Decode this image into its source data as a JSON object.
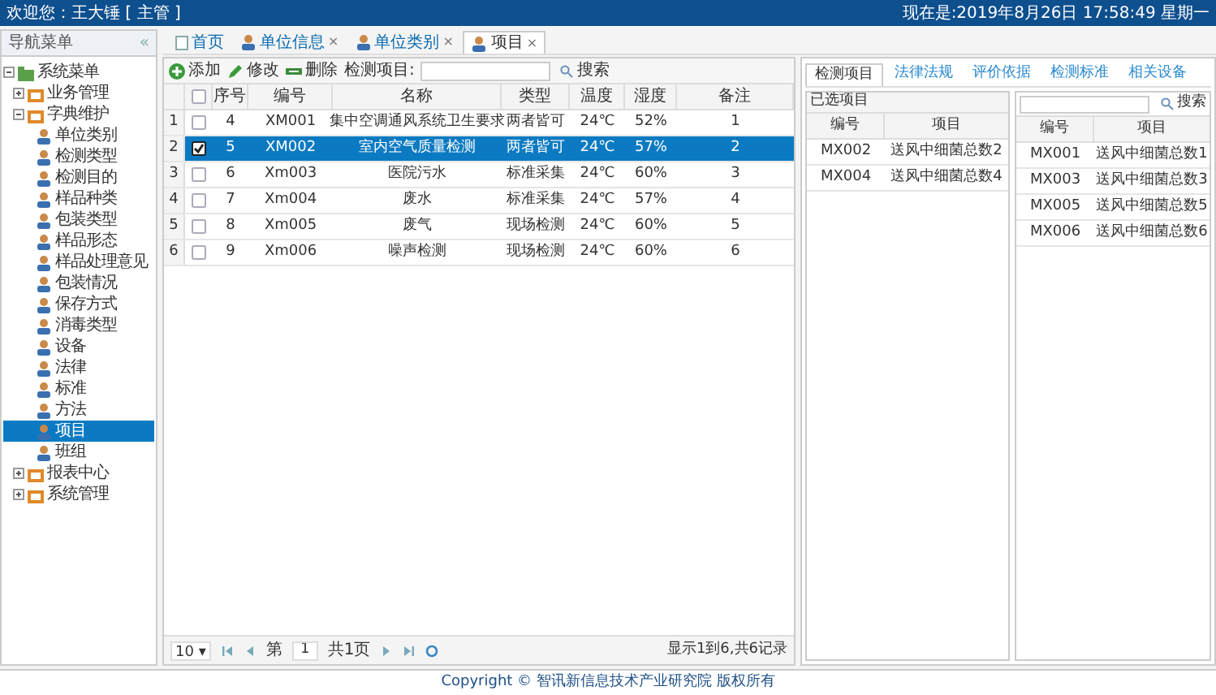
{
  "header": {
    "welcome": "欢迎您：王大锤 [ 主管 ]",
    "clock": "现在是:2019年8月26日 17:58:49 星期一"
  },
  "sidebar": {
    "title": "导航菜单",
    "collapse": "«",
    "tree": [
      {
        "label": "系统菜单",
        "expanded": true,
        "selected": false,
        "children": [
          {
            "label": "业务管理",
            "expanded": false,
            "selected": false
          },
          {
            "label": "字典维护",
            "expanded": true,
            "selected": false,
            "children": [
              {
                "label": "单位类别",
                "selected": false
              },
              {
                "label": "检测类型",
                "selected": false
              },
              {
                "label": "检测目的",
                "selected": false
              },
              {
                "label": "样品种类",
                "selected": false
              },
              {
                "label": "包装类型",
                "selected": false
              },
              {
                "label": "样品形态",
                "selected": false
              },
              {
                "label": "样品处理意见",
                "selected": false
              },
              {
                "label": "包装情况",
                "selected": false
              },
              {
                "label": "保存方式",
                "selected": false
              },
              {
                "label": "消毒类型",
                "selected": false
              },
              {
                "label": "设备",
                "selected": false
              },
              {
                "label": "法律",
                "selected": false
              },
              {
                "label": "标准",
                "selected": false
              },
              {
                "label": "方法",
                "selected": false
              },
              {
                "label": "项目",
                "selected": true
              },
              {
                "label": "班组",
                "selected": false
              }
            ]
          },
          {
            "label": "报表中心",
            "expanded": false,
            "selected": false
          },
          {
            "label": "系统管理",
            "expanded": false,
            "selected": false
          }
        ]
      }
    ]
  },
  "tabs": [
    {
      "label": "首页",
      "selected": false
    },
    {
      "label": "单位信息",
      "close": "×",
      "selected": false
    },
    {
      "label": "单位类别",
      "close": "×",
      "selected": false
    },
    {
      "label": "项目",
      "close": "×",
      "selected": true
    }
  ],
  "toolbar": {
    "add": "添加",
    "edit": "修改",
    "delete": "删除",
    "search_label": "检测项目:",
    "search": "搜索"
  },
  "table": {
    "select_all_checked": false,
    "columns": [
      "序号",
      "编号",
      "名称",
      "类型",
      "温度",
      "湿度",
      "备注"
    ],
    "rows": [
      {
        "n": "1",
        "checked": false,
        "selected": false,
        "cells": [
          "4",
          "XM001",
          "集中空调通风系统卫生要求",
          "两者皆可",
          "24℃",
          "52%",
          "1"
        ]
      },
      {
        "n": "2",
        "checked": true,
        "selected": true,
        "cells": [
          "5",
          "XM002",
          "室内空气质量检测",
          "两者皆可",
          "24℃",
          "57%",
          "2"
        ]
      },
      {
        "n": "3",
        "checked": false,
        "selected": false,
        "cells": [
          "6",
          "Xm003",
          "医院污水",
          "标准采集",
          "24℃",
          "60%",
          "3"
        ]
      },
      {
        "n": "4",
        "checked": false,
        "selected": false,
        "cells": [
          "7",
          "Xm004",
          "废水",
          "标准采集",
          "24℃",
          "57%",
          "4"
        ]
      },
      {
        "n": "5",
        "checked": false,
        "selected": false,
        "cells": [
          "8",
          "Xm005",
          "废气",
          "现场检测",
          "24℃",
          "60%",
          "5"
        ]
      },
      {
        "n": "6",
        "checked": false,
        "selected": false,
        "cells": [
          "9",
          "Xm006",
          "噪声检测",
          "现场检测",
          "24℃",
          "60%",
          "6"
        ]
      }
    ]
  },
  "pager": {
    "page_size": "10",
    "page_size_arrow": "▾",
    "page_prefix": "第",
    "page": "1",
    "page_total": "共1页",
    "summary": "显示1到6,共6记录"
  },
  "detail": {
    "tabs": [
      {
        "label": "检测项目",
        "selected": true
      },
      {
        "label": "法律法规",
        "selected": false
      },
      {
        "label": "评价依据",
        "selected": false
      },
      {
        "label": "检测标准",
        "selected": false
      },
      {
        "label": "相关设备",
        "selected": false
      }
    ],
    "selected_title": "已选项目",
    "columns": [
      "编号",
      "项目"
    ],
    "selected_rows": [
      [
        "MX002",
        "送风中细菌总数2"
      ],
      [
        "MX004",
        "送风中细菌总数4"
      ]
    ],
    "search": "搜索",
    "columns_2": [
      "编号",
      "项目"
    ],
    "available_rows": [
      [
        "MX001",
        "送风中细菌总数1"
      ],
      [
        "MX003",
        "送风中细菌总数3"
      ],
      [
        "MX005",
        "送风中细菌总数5"
      ],
      [
        "MX006",
        "送风中细菌总数6"
      ]
    ]
  },
  "footer": "Copyright © 智讯新信息技术产业研究院 版权所有"
}
